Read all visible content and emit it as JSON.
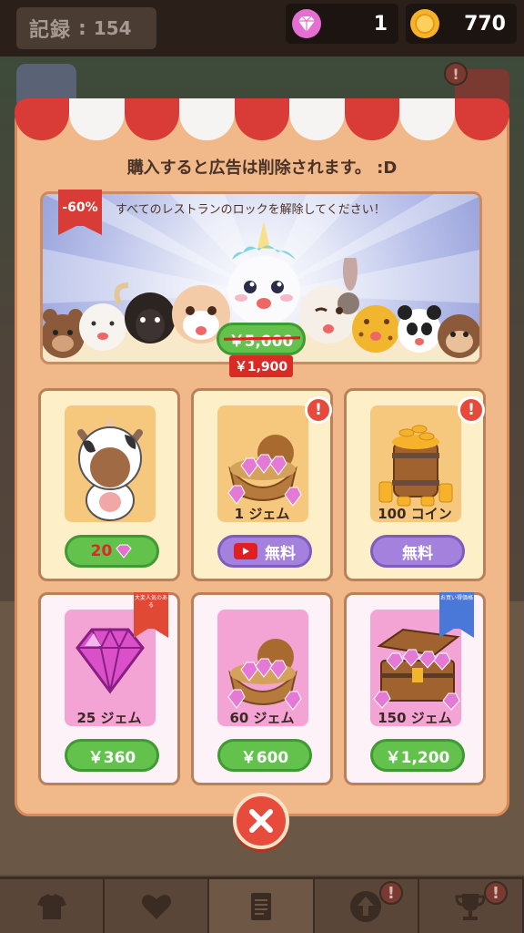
{
  "hud": {
    "record_label": "記録",
    "record_colon": ":",
    "record_value": "154",
    "gems": "1",
    "coins": "770"
  },
  "modal": {
    "notice": "購入すると広告は削除されます。 :D",
    "banner": {
      "title": "すべてのレストランのロックを解除してください！",
      "discount": "-60%",
      "old_price": "￥5,000",
      "new_price": "￥1,900"
    },
    "items": [
      {
        "label": "",
        "button": "20",
        "button_icon": "gem-icon",
        "style": "green"
      },
      {
        "label": "1 ジェム",
        "button": "無料",
        "button_icon": "video-ad-icon",
        "style": "purple",
        "alert": "!"
      },
      {
        "label": "100 コイン",
        "button": "無料",
        "style": "purple",
        "alert": "!"
      },
      {
        "label": "25 ジェム",
        "button": "￥360",
        "style": "green",
        "ribbon": "大変人気のある"
      },
      {
        "label": "60 ジェム",
        "button": "￥600",
        "style": "green"
      },
      {
        "label": "150 ジェム",
        "button": "￥1,200",
        "style": "green",
        "ribbon": "お買い得価格"
      }
    ]
  },
  "bottom_nav": {
    "items": [
      "shirt-icon",
      "heart-icon",
      "document-icon",
      "upgrade-arrow-icon",
      "trophy-icon"
    ],
    "alerts": [
      "!",
      "!"
    ]
  },
  "colors": {
    "red": "#d93b36",
    "green": "#63c24c",
    "purple": "#a481dd",
    "modal_bg": "#f1b98a"
  }
}
